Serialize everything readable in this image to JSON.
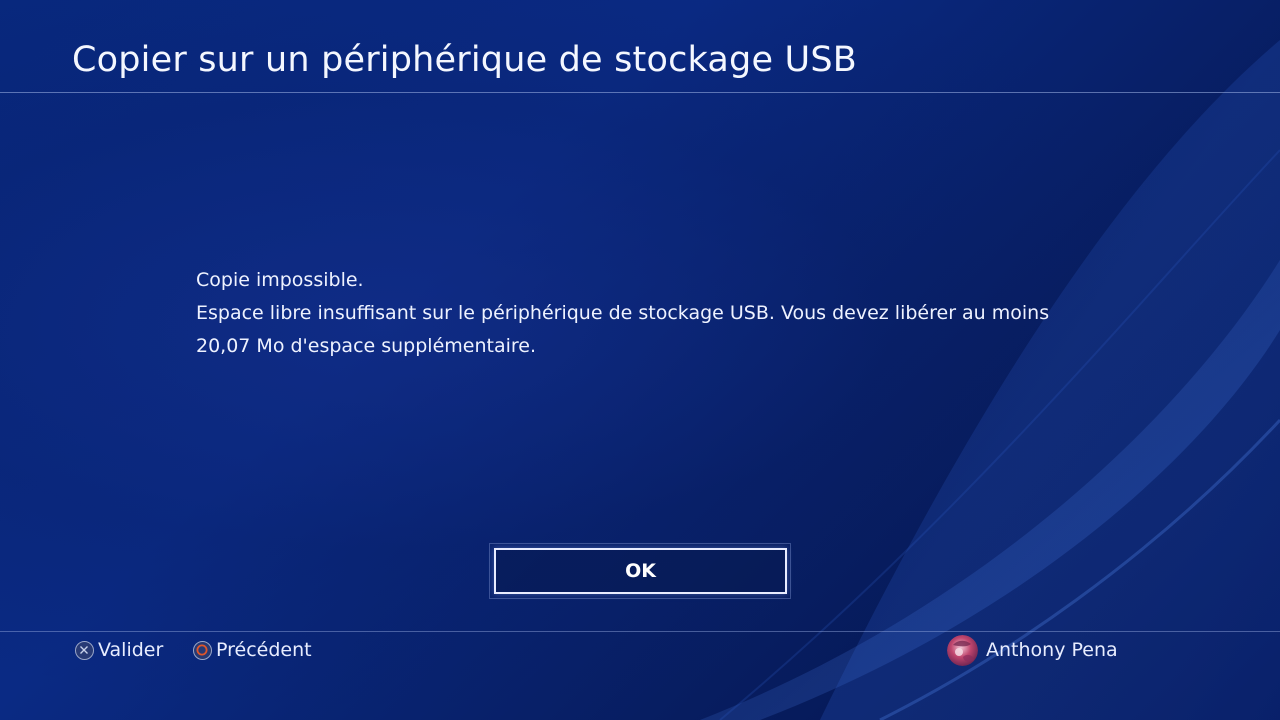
{
  "header": {
    "title": "Copier sur un périphérique de stockage USB"
  },
  "dialog": {
    "line1": "Copie impossible.",
    "line2": "Espace libre insuffisant sur le périphérique de stockage USB. Vous devez libérer au moins",
    "line3": "20,07 Mo d'espace supplémentaire.",
    "ok_label": "OK"
  },
  "footer": {
    "confirm": {
      "icon": "cross-button-icon",
      "label": "Valider"
    },
    "back": {
      "icon": "circle-button-icon",
      "label": "Précédent"
    },
    "user": {
      "icon": "avatar",
      "name": "Anthony Pena"
    }
  },
  "colors": {
    "background": "#0a2a84",
    "text": "#f2f5ff",
    "circle_button": "#e0552a"
  }
}
